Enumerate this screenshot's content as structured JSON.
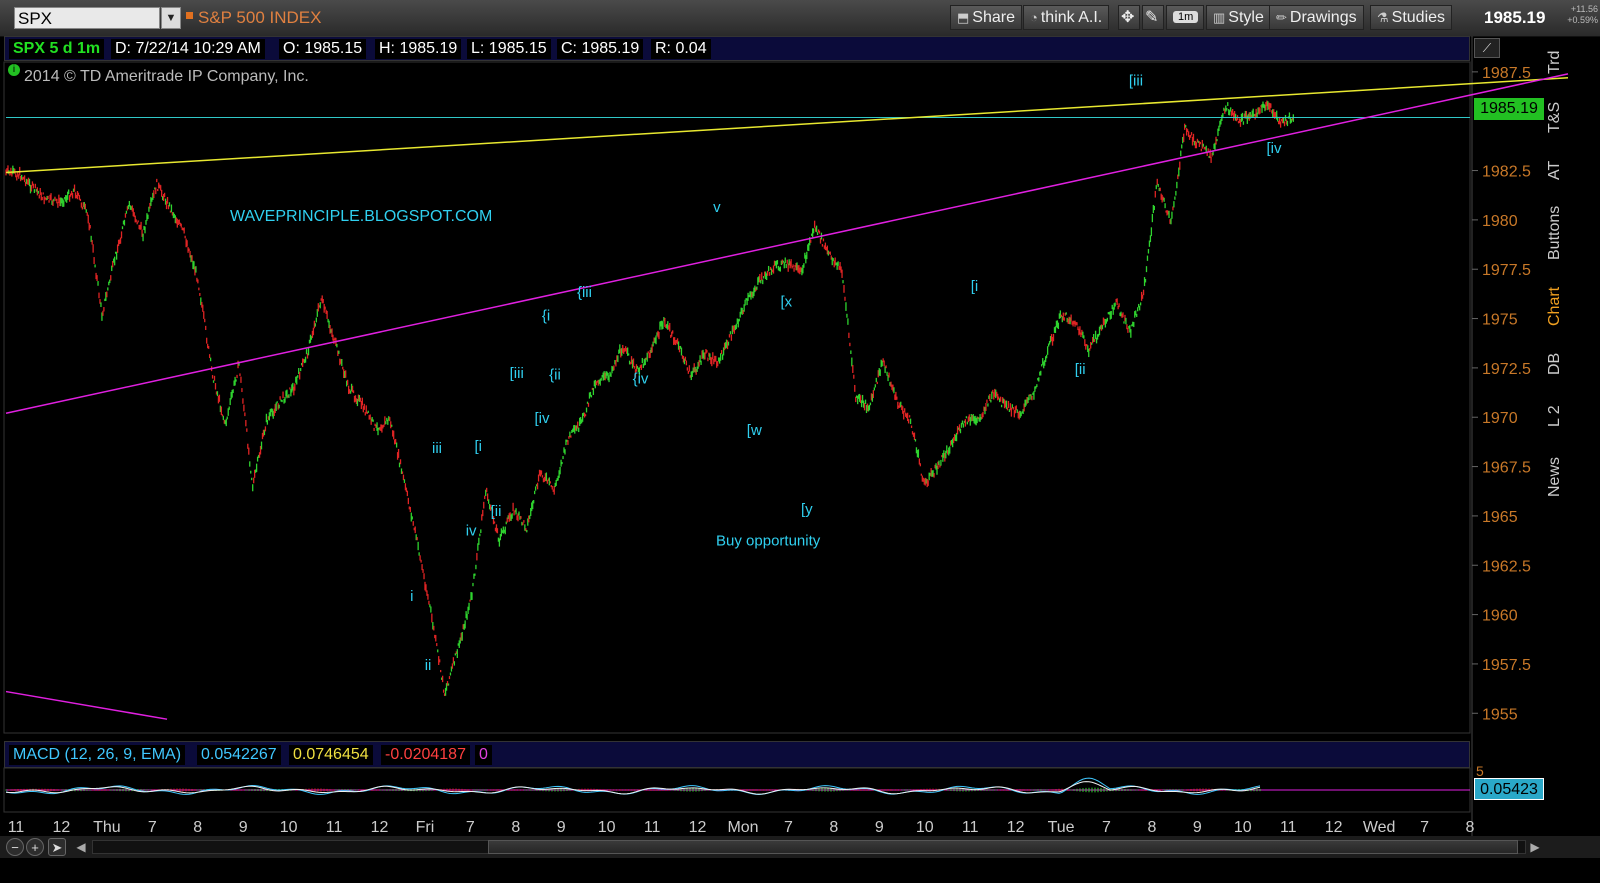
{
  "toolbar": {
    "symbol": "SPX",
    "symbol_name": "S&P 500 INDEX",
    "share": "Share",
    "think_ai": "think A.I.",
    "interval_badge": "1m",
    "style": "Style",
    "drawings": "Drawings",
    "studies": "Studies",
    "last_price": "1985.19",
    "net_change": "+11.56",
    "pct_change": "+0.59%"
  },
  "info_bar": {
    "title": "SPX 5 d 1m",
    "date": "D: 7/22/14 10:29 AM",
    "open": "O: 1985.15",
    "high": "H: 1985.19",
    "low": "L: 1985.15",
    "close": "C: 1985.19",
    "range": "R: 0.04"
  },
  "copyright": "2014 © TD Ameritrade IP Company, Inc.",
  "watermark": "WAVEPRINCIPLE.BLOGSPOT.COM",
  "macd": {
    "label": "MACD (12, 26, 9, EMA)",
    "value": "0.0542267",
    "avg": "0.0746454",
    "diff": "-0.0204187",
    "zero": "0",
    "current_tag": "0.05423",
    "axis_tick": "5"
  },
  "right_tabs": [
    "Trd",
    "T&S",
    "AT",
    "Buttons",
    "Chart",
    "DB",
    "L 2",
    "News"
  ],
  "colors": {
    "up": "#2fd42f",
    "down": "#e02424",
    "trend_yellow": "#e8e830",
    "trend_magenta": "#e020e0",
    "last_price_line": "#30c8c8",
    "label_cyan": "#30d0f0",
    "axis_text": "#c87828"
  },
  "chart_data": {
    "type": "line",
    "title": "SPX 5 d 1m",
    "ylim": [
      1954,
      1988
    ],
    "yticks": [
      "1955",
      "1957.5",
      "1960",
      "1962.5",
      "1965",
      "1967.5",
      "1970",
      "1972.5",
      "1975",
      "1977.5",
      "1980",
      "1982.5",
      "1987.5"
    ],
    "last_price": 1985.19,
    "xticks": [
      "11",
      "12",
      "Thu",
      "7",
      "8",
      "9",
      "10",
      "11",
      "12",
      "Fri",
      "7",
      "8",
      "9",
      "10",
      "11",
      "12",
      "Mon",
      "7",
      "8",
      "9",
      "10",
      "11",
      "12",
      "Tue",
      "7",
      "8",
      "9",
      "10",
      "11",
      "12",
      "Wed",
      "7",
      "8"
    ],
    "series": [
      {
        "values": [
          1982.4,
          1982.3,
          1981.6,
          1981.0,
          1980.9,
          1981.5,
          1980.2,
          1975.2,
          1978.2,
          1980.8,
          1979.3,
          1981.8,
          1980.6,
          1979.3,
          1977.0,
          1972.4,
          1969.6,
          1972.7,
          1966.5,
          1969.8,
          1970.8,
          1971.5,
          1973.3,
          1976.0,
          1973.8,
          1971.5,
          1970.6,
          1969.4,
          1969.9,
          1966.9,
          1963.7,
          1960.1,
          1956.0,
          1958.3,
          1961.0,
          1966.3,
          1963.8,
          1965.3,
          1964.4,
          1967.2,
          1966.3,
          1968.9,
          1969.7,
          1971.8,
          1972.1,
          1973.6,
          1972.3,
          1973.3,
          1974.9,
          1973.7,
          1972.1,
          1973.2,
          1972.8,
          1974.3,
          1975.8,
          1976.9,
          1977.6,
          1977.8,
          1977.3,
          1979.7,
          1978.3,
          1977.4,
          1971.0,
          1970.5,
          1972.9,
          1970.8,
          1969.8,
          1966.6,
          1967.5,
          1968.7,
          1969.8,
          1969.9,
          1971.2,
          1970.5,
          1970.2,
          1971.3,
          1973.4,
          1975.2,
          1974.8,
          1973.4,
          1974.6,
          1975.8,
          1974.3,
          1976.3,
          1982.0,
          1979.8,
          1984.6,
          1983.8,
          1983.2,
          1985.8,
          1985.0,
          1985.3,
          1985.9,
          1984.9,
          1985.19
        ]
      }
    ],
    "trendlines": [
      {
        "color": "yellow",
        "from": [
          0,
          1982.4
        ],
        "to": [
          1.0,
          1987.2
        ]
      },
      {
        "color": "magenta",
        "from": [
          0,
          1970.2
        ],
        "to": [
          1.0,
          1987.4
        ]
      },
      {
        "color": "magenta",
        "from": [
          0,
          1956.1
        ],
        "to": [
          0.11,
          1954.7
        ]
      }
    ],
    "wave_labels": [
      {
        "text": "i",
        "x": 0.276,
        "y": 1960.7
      },
      {
        "text": "ii",
        "x": 0.286,
        "y": 1957.2
      },
      {
        "text": "iii",
        "x": 0.291,
        "y": 1968.2
      },
      {
        "text": "iv",
        "x": 0.314,
        "y": 1964.0
      },
      {
        "text": "[i",
        "x": 0.32,
        "y": 1968.3
      },
      {
        "text": "[ii",
        "x": 0.331,
        "y": 1965.0
      },
      {
        "text": "[iii",
        "x": 0.344,
        "y": 1972.0
      },
      {
        "text": "[iv",
        "x": 0.361,
        "y": 1969.7
      },
      {
        "text": "{i",
        "x": 0.366,
        "y": 1974.9
      },
      {
        "text": "{ii",
        "x": 0.371,
        "y": 1971.9
      },
      {
        "text": "{iii",
        "x": 0.39,
        "y": 1976.1
      },
      {
        "text": "{iv",
        "x": 0.428,
        "y": 1971.7
      },
      {
        "text": "v",
        "x": 0.483,
        "y": 1980.4
      },
      {
        "text": "[x",
        "x": 0.529,
        "y": 1975.6
      },
      {
        "text": "[w",
        "x": 0.506,
        "y": 1969.1
      },
      {
        "text": "[y",
        "x": 0.543,
        "y": 1965.1
      },
      {
        "text": "Buy opportunity",
        "x": 0.485,
        "y": 1963.5
      },
      {
        "text": "[i",
        "x": 0.659,
        "y": 1976.4
      },
      {
        "text": "[ii",
        "x": 0.73,
        "y": 1972.2
      },
      {
        "text": "[iii",
        "x": 0.767,
        "y": 1986.8
      },
      {
        "text": "[iv",
        "x": 0.861,
        "y": 1983.4
      }
    ]
  }
}
